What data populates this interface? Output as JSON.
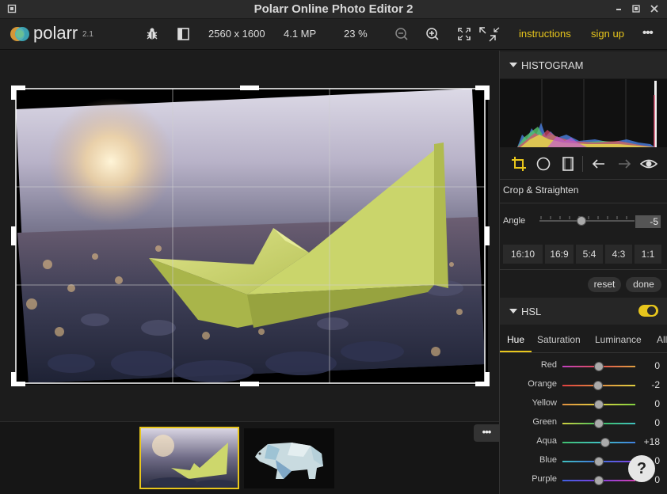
{
  "window": {
    "title": "Polarr Online Photo Editor 2",
    "controls": [
      "minimize-icon",
      "restore-icon",
      "close-icon"
    ]
  },
  "toolbar": {
    "logo_text": "polarr",
    "version": "2.1",
    "dimensions": "2560 x 1600",
    "megapixels": "4.1 MP",
    "zoom": "23 %",
    "instructions_label": "instructions",
    "signup_label": "sign up",
    "more_label": "•••"
  },
  "histogram": {
    "title": "HISTOGRAM"
  },
  "crop": {
    "title": "Crop & Straighten",
    "angle_label": "Angle",
    "angle_value": "-5",
    "ratios": [
      "16:10",
      "16:9",
      "5:4",
      "4:3",
      "1:1"
    ],
    "reset_label": "reset",
    "done_label": "done"
  },
  "hsl": {
    "title": "HSL",
    "enabled": true,
    "tabs": [
      "Hue",
      "Saturation",
      "Luminance",
      "All"
    ],
    "active_tab": "Hue",
    "rows": [
      {
        "name": "Red",
        "value": "0",
        "level": 0.5
      },
      {
        "name": "Orange",
        "value": "-2",
        "level": 0.49
      },
      {
        "name": "Yellow",
        "value": "0",
        "level": 0.5
      },
      {
        "name": "Green",
        "value": "0",
        "level": 0.5
      },
      {
        "name": "Aqua",
        "value": "+18",
        "level": 0.59
      },
      {
        "name": "Blue",
        "value": "0",
        "level": 0.5
      },
      {
        "name": "Purple",
        "value": "0",
        "level": 0.5
      }
    ]
  },
  "filmstrip": {
    "more_label": "•••",
    "items": [
      "paper-boat-thumbnail",
      "polar-bear-thumbnail"
    ],
    "selected": 0
  },
  "help_label": "?",
  "colors": {
    "accent": "#e8c61c",
    "panel_bg": "#1c1c1c"
  }
}
